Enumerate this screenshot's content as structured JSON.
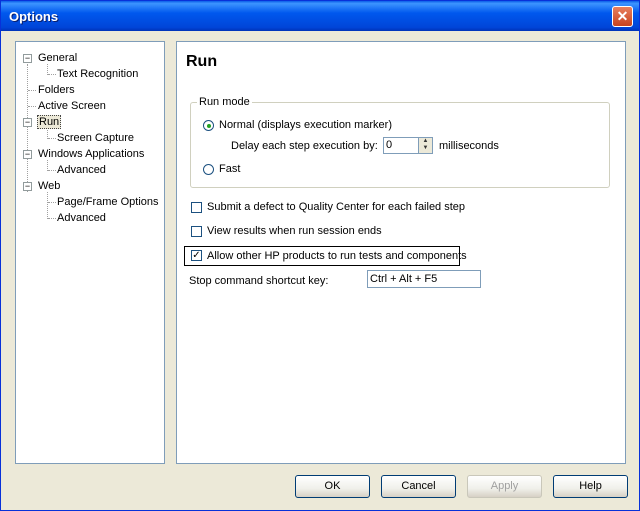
{
  "window": {
    "title": "Options",
    "close_glyph": "✕"
  },
  "tree": {
    "items": [
      {
        "label": "General",
        "expanded": true
      },
      {
        "label": "Text Recognition"
      },
      {
        "label": "Folders"
      },
      {
        "label": "Active Screen"
      },
      {
        "label": "Run",
        "expanded": true,
        "selected": true
      },
      {
        "label": "Screen Capture"
      },
      {
        "label": "Windows Applications",
        "expanded": true
      },
      {
        "label": "Advanced"
      },
      {
        "label": "Web",
        "expanded": true
      },
      {
        "label": "Page/Frame Options"
      },
      {
        "label": "Advanced"
      }
    ],
    "collapse_glyph": "−"
  },
  "run": {
    "title": "Run",
    "run_mode": {
      "label": "Run mode",
      "normal_label": "Normal (displays execution marker)",
      "normal_selected": true,
      "delay_label": "Delay each step execution by:",
      "delay_value": "0",
      "delay_unit": "milliseconds",
      "fast_label": "Fast",
      "fast_selected": false
    },
    "submit_defect": {
      "label": "Submit a defect to Quality Center for each failed step",
      "checked": false
    },
    "view_results": {
      "label": "View results when run session ends",
      "checked": false
    },
    "allow_hp": {
      "label": "Allow other HP products to run tests and components",
      "checked": true
    },
    "check_glyph": "✓",
    "stop_shortcut": {
      "label": "Stop command shortcut key:",
      "value": "Ctrl + Alt + F5"
    }
  },
  "buttons": {
    "ok": "OK",
    "cancel": "Cancel",
    "apply": "Apply",
    "help": "Help"
  },
  "icons": {
    "spin_up": "▲",
    "spin_down": "▼"
  }
}
